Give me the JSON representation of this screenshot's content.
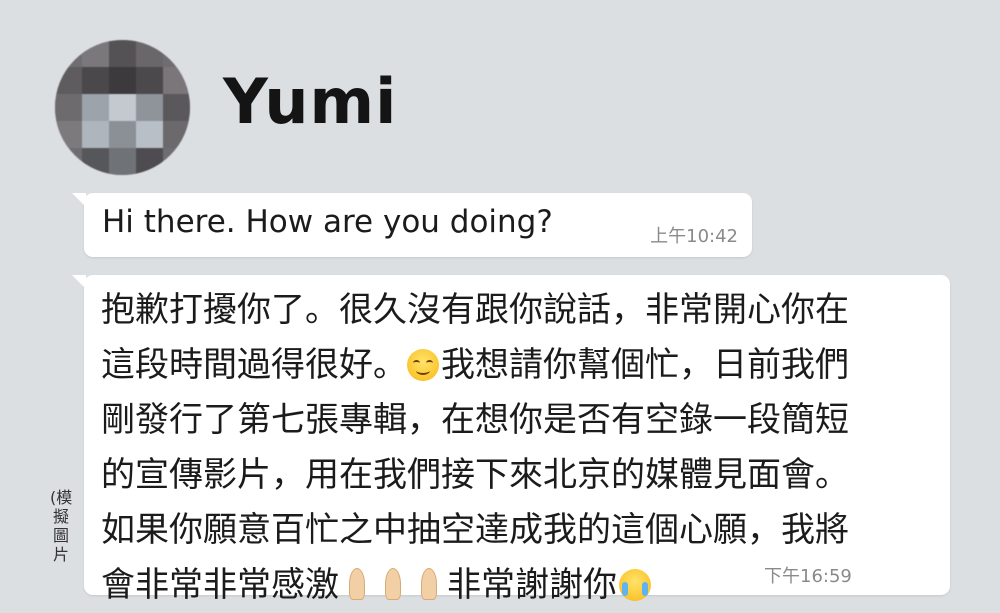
{
  "contact": {
    "name": "Yumi",
    "avatar_style": "pixelated"
  },
  "messages": [
    {
      "text": "Hi there. How are you doing?",
      "time": "上午10:42"
    },
    {
      "lines": [
        "抱歉打擾你了。很久沒有跟你說話，非常開心你在",
        "這段時間過得很好。",
        "我想請你幫個忙，日前我們",
        "剛發行了第七張專輯，在想你是否有空錄一段簡短",
        "的宣傳影片，用在我們接下來北京的媒體見面會。",
        "如果你願意百忙之中抽空達成我的這個心願，我將",
        "會非常非常感激",
        "非常謝謝你"
      ],
      "emoji": [
        "smiling-face",
        "folded-hands",
        "folded-hands",
        "folded-hands",
        "crying-face"
      ],
      "time": "下午16:59"
    }
  ],
  "side_caption": "(模擬圖片",
  "colors": {
    "background": "#dcdfe2",
    "bubble": "#ffffff",
    "text": "#1b1b1b",
    "timestamp": "#8a8a8a"
  }
}
